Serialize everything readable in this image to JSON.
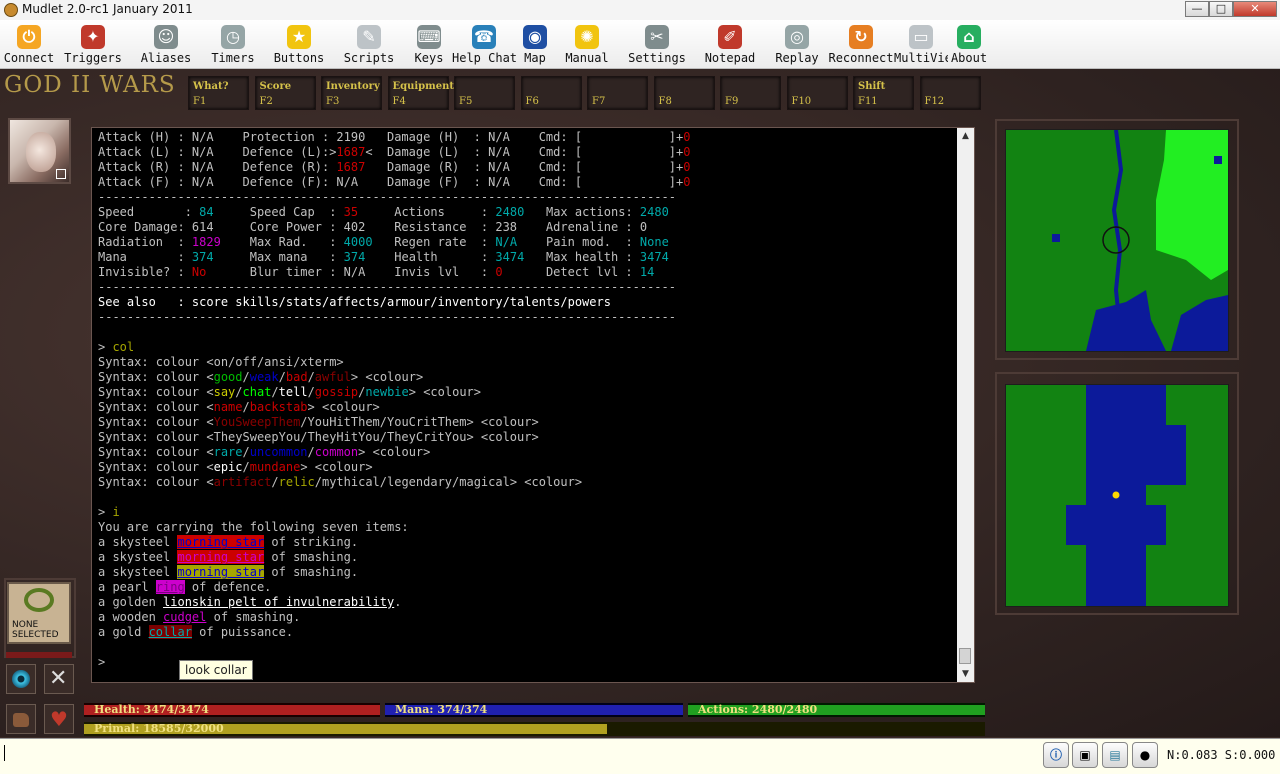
{
  "window": {
    "title": "Mudlet 2.0-rc1 January 2011",
    "min": "—",
    "max": "□",
    "close": "✕"
  },
  "toolbar": [
    {
      "label": "Connect",
      "icon": "connect-icon",
      "color": "#f5a623",
      "glyph": "⏻"
    },
    {
      "label": "Triggers",
      "icon": "triggers-icon",
      "color": "#c0392b",
      "glyph": "✦"
    },
    {
      "label": "Aliases",
      "icon": "aliases-icon",
      "color": "#7f8c8d",
      "glyph": "☺"
    },
    {
      "label": "Timers",
      "icon": "timers-icon",
      "color": "#95a5a6",
      "glyph": "◷"
    },
    {
      "label": "Buttons",
      "icon": "buttons-icon",
      "color": "#f1c40f",
      "glyph": "★"
    },
    {
      "label": "Scripts",
      "icon": "scripts-icon",
      "color": "#bdc3c7",
      "glyph": "✎"
    },
    {
      "label": "Keys",
      "icon": "keys-icon",
      "color": "#7f8c8d",
      "glyph": "⌨"
    },
    {
      "label": "Help Chat",
      "icon": "help-chat-icon",
      "color": "#2980b9",
      "glyph": "☎"
    },
    {
      "label": "Map",
      "icon": "map-icon",
      "color": "#1f4fa3",
      "glyph": "◉"
    },
    {
      "label": "Manual",
      "icon": "manual-icon",
      "color": "#f1c40f",
      "glyph": "✺"
    },
    {
      "label": "Settings",
      "icon": "settings-icon",
      "color": "#7f8c8d",
      "glyph": "✂"
    },
    {
      "label": "Notepad",
      "icon": "notepad-icon",
      "color": "#c0392b",
      "glyph": "✐"
    },
    {
      "label": "Replay",
      "icon": "replay-icon",
      "color": "#95a5a6",
      "glyph": "◎"
    },
    {
      "label": "Reconnect",
      "icon": "reconnect-icon",
      "color": "#e67e22",
      "glyph": "↻"
    },
    {
      "label": "MultiView",
      "icon": "multiview-icon",
      "color": "#bdc3c7",
      "glyph": "▭"
    },
    {
      "label": "About",
      "icon": "about-icon",
      "color": "#27ae60",
      "glyph": "⌂"
    }
  ],
  "logo": {
    "text": "GOD II WARS"
  },
  "fkeys": [
    {
      "title": "What?",
      "key": "F1"
    },
    {
      "title": "Score",
      "key": "F2"
    },
    {
      "title": "Inventory",
      "key": "F3"
    },
    {
      "title": "Equipment",
      "key": "F4"
    },
    {
      "title": "",
      "key": "F5"
    },
    {
      "title": "",
      "key": "F6"
    },
    {
      "title": "",
      "key": "F7"
    },
    {
      "title": "",
      "key": "F8"
    },
    {
      "title": "",
      "key": "F9"
    },
    {
      "title": "",
      "key": "F10"
    },
    {
      "title": "Shift",
      "key": "F11"
    },
    {
      "title": "",
      "key": "F12"
    }
  ],
  "colors": {
    "default": "#c0c0c0",
    "white": "#ffffff",
    "red": "#cc0000",
    "darkred": "#8b0000",
    "green": "#00bb00",
    "yellow": "#cccc00",
    "blue": "#0000cc",
    "magenta": "#cc00cc",
    "cyan": "#00aaaa",
    "brightgreen": "#00ff00",
    "olive": "#a6a600",
    "hpbar": "#b02020",
    "mpbar": "#2020b0",
    "mvbar": "#20a020",
    "primal": "#b0a020"
  },
  "terminal_lines": [
    [
      [
        "Attack (H) : N/A    Protection : 2190   Damage (H)  : N/A    Cmd: [            ]+",
        ""
      ],
      [
        "0",
        "red"
      ]
    ],
    [
      [
        "Attack (L) : N/A    Defence (L):>",
        ""
      ],
      [
        "1687",
        "red"
      ],
      [
        "<  Damage (L)  : N/A    Cmd: [            ]+",
        ""
      ],
      [
        "0",
        "red"
      ]
    ],
    [
      [
        "Attack (R) : N/A    Defence (R): ",
        ""
      ],
      [
        "1687",
        "red"
      ],
      [
        "   Damage (R)  : N/A    Cmd: [            ]+",
        ""
      ],
      [
        "0",
        "red"
      ]
    ],
    [
      [
        "Attack (F) : N/A    Defence (F): N/A    Damage (F)  : N/A    Cmd: [            ]+",
        ""
      ],
      [
        "0",
        "red"
      ]
    ],
    [
      [
        "--------------------------------------------------------------------------------",
        ""
      ]
    ],
    [
      [
        "Speed       : ",
        ""
      ],
      [
        "84",
        "cyan"
      ],
      [
        "     Speed Cap  : ",
        ""
      ],
      [
        "35",
        "red"
      ],
      [
        "     Actions     : ",
        ""
      ],
      [
        "2480",
        "cyan"
      ],
      [
        "   Max actions: ",
        ""
      ],
      [
        "2480",
        "cyan"
      ]
    ],
    [
      [
        "Core Damage: 614     Core Power : 402    Resistance  : 238    Adrenaline : 0",
        ""
      ]
    ],
    [
      [
        "Radiation  : ",
        ""
      ],
      [
        "1829",
        "magenta"
      ],
      [
        "    Max Rad.   : ",
        ""
      ],
      [
        "4000",
        "cyan"
      ],
      [
        "   Regen rate  : ",
        ""
      ],
      [
        "N/A",
        "cyan"
      ],
      [
        "    Pain mod.  : ",
        ""
      ],
      [
        "None",
        "cyan"
      ]
    ],
    [
      [
        "Mana       : ",
        ""
      ],
      [
        "374",
        "cyan"
      ],
      [
        "     Max mana   : ",
        ""
      ],
      [
        "374",
        "cyan"
      ],
      [
        "    Health      : ",
        ""
      ],
      [
        "3474",
        "cyan"
      ],
      [
        "   Max health : ",
        ""
      ],
      [
        "3474",
        "cyan"
      ]
    ],
    [
      [
        "Invisible? : ",
        ""
      ],
      [
        "No",
        "red"
      ],
      [
        "      Blur timer : N/A    Invis lvl   : ",
        ""
      ],
      [
        "0",
        "red"
      ],
      [
        "      Detect lvl : ",
        ""
      ],
      [
        "14",
        "cyan"
      ]
    ],
    [
      [
        "--------------------------------------------------------------------------------",
        ""
      ]
    ],
    [
      [
        "See also   : score skills/stats/affects/armour/inventory/talents/powers",
        "white"
      ]
    ],
    [
      [
        "--------------------------------------------------------------------------------",
        ""
      ]
    ],
    [
      [
        "",
        ""
      ]
    ],
    [
      [
        "> ",
        ""
      ],
      [
        "col",
        "olive"
      ]
    ],
    [
      [
        "Syntax: colour <on/off/ansi/xterm>",
        ""
      ]
    ],
    [
      [
        "Syntax: colour <",
        ""
      ],
      [
        "good",
        "green"
      ],
      [
        "/",
        ""
      ],
      [
        "weak",
        "blue"
      ],
      [
        "/",
        ""
      ],
      [
        "bad",
        "red"
      ],
      [
        "/",
        ""
      ],
      [
        "awful",
        "darkred"
      ],
      [
        "> <colour>",
        ""
      ]
    ],
    [
      [
        "Syntax: colour <",
        ""
      ],
      [
        "say",
        "yellow"
      ],
      [
        "/",
        ""
      ],
      [
        "chat",
        "brightgreen"
      ],
      [
        "/",
        ""
      ],
      [
        "tell",
        "white"
      ],
      [
        "/",
        ""
      ],
      [
        "gossip",
        "red"
      ],
      [
        "/",
        ""
      ],
      [
        "newbie",
        "cyan"
      ],
      [
        "> <colour>",
        ""
      ]
    ],
    [
      [
        "Syntax: colour <",
        ""
      ],
      [
        "name",
        "red"
      ],
      [
        "/",
        ""
      ],
      [
        "backstab",
        "red"
      ],
      [
        "> <colour>",
        ""
      ]
    ],
    [
      [
        "Syntax: colour <",
        ""
      ],
      [
        "YouSweepThem",
        "darkred"
      ],
      [
        "/YouHitThem/YouCritThem> <colour>",
        ""
      ]
    ],
    [
      [
        "Syntax: colour <TheySweepYou/TheyHitYou/TheyCritYou> <colour>",
        ""
      ]
    ],
    [
      [
        "Syntax: colour <",
        ""
      ],
      [
        "rare",
        "cyan"
      ],
      [
        "/",
        ""
      ],
      [
        "uncommon",
        "blue"
      ],
      [
        "/",
        ""
      ],
      [
        "common",
        "magenta"
      ],
      [
        "> <colour>",
        ""
      ]
    ],
    [
      [
        "Syntax: colour <",
        ""
      ],
      [
        "epic",
        "white"
      ],
      [
        "/",
        ""
      ],
      [
        "mundane",
        "red"
      ],
      [
        "> <colour>",
        ""
      ]
    ],
    [
      [
        "Syntax: colour <",
        ""
      ],
      [
        "artifact",
        "darkred"
      ],
      [
        "/",
        ""
      ],
      [
        "relic",
        "olive"
      ],
      [
        "/mythical/legendary/magical> <colour>",
        ""
      ]
    ],
    [
      [
        "",
        ""
      ]
    ],
    [
      [
        "> ",
        ""
      ],
      [
        "i",
        "olive"
      ]
    ],
    [
      [
        "You are carrying the following seven items:",
        ""
      ]
    ],
    [
      [
        "a skysteel ",
        ""
      ],
      [
        "morning star",
        "hl-red-blue"
      ],
      [
        " of striking.",
        ""
      ]
    ],
    [
      [
        "a skysteel ",
        ""
      ],
      [
        "morning star",
        "hl-red-mag"
      ],
      [
        " of smashing.",
        ""
      ]
    ],
    [
      [
        "a skysteel ",
        ""
      ],
      [
        "morning star",
        "hl-olive-blue"
      ],
      [
        " of smashing.",
        ""
      ]
    ],
    [
      [
        "a pearl ",
        ""
      ],
      [
        "ring",
        "hl-mag-mag"
      ],
      [
        " of defence.",
        ""
      ]
    ],
    [
      [
        "a golden ",
        ""
      ],
      [
        "lionskin pelt of invulnerability",
        "ul-white"
      ],
      [
        ".",
        ""
      ]
    ],
    [
      [
        "a wooden ",
        ""
      ],
      [
        "cudgel",
        "ul-mag"
      ],
      [
        " of smashing.",
        ""
      ]
    ],
    [
      [
        "a gold ",
        ""
      ],
      [
        "collar",
        "hl-collar"
      ],
      [
        " of puissance.",
        ""
      ]
    ],
    [
      [
        "",
        ""
      ]
    ],
    [
      [
        "> ",
        ""
      ]
    ]
  ],
  "tooltip": "look collar",
  "left_panel": {
    "selection_text_1": "NONE",
    "selection_text_2": "SELECTED"
  },
  "bars": {
    "health": {
      "label": "Health: 3474/3474",
      "fraction": 1.0
    },
    "mana": {
      "label": "Mana: 374/374",
      "fraction": 1.0
    },
    "actions": {
      "label": "Actions: 2480/2480",
      "fraction": 1.0
    },
    "primal": {
      "label": "Primal: 18585/32000",
      "fraction": 0.58
    }
  },
  "command_line": {
    "value": ""
  },
  "status": {
    "net": "N:0.083 S:0.000"
  }
}
